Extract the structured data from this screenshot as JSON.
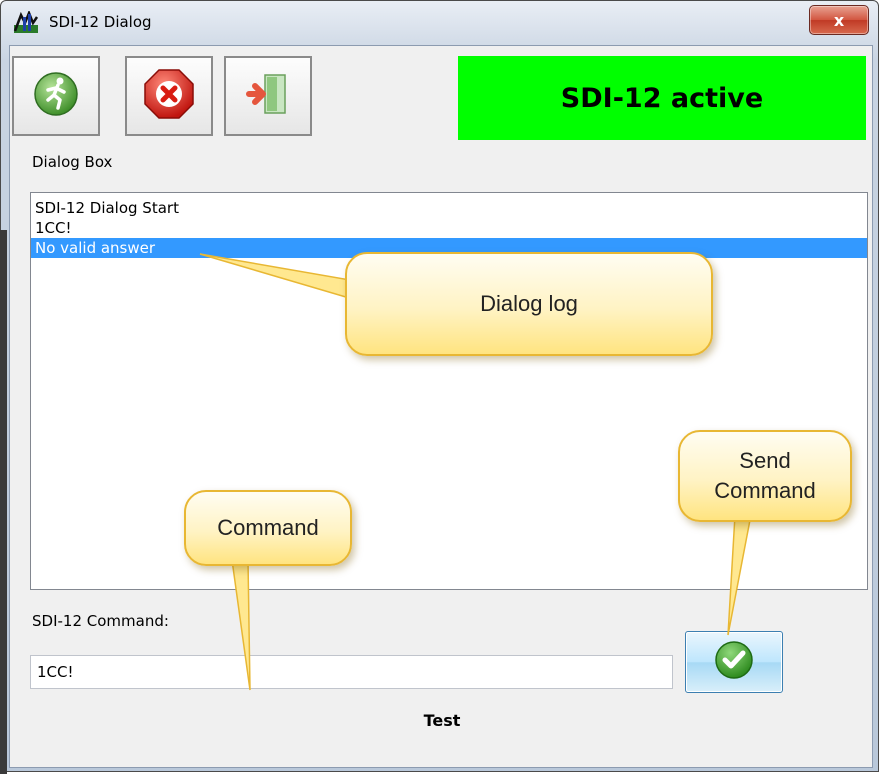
{
  "window": {
    "title": "SDI-12 Dialog",
    "close_label": "x"
  },
  "toolbar": {
    "run_icon": "running-man-icon",
    "stop_icon": "stop-x-icon",
    "exit_icon": "exit-door-icon"
  },
  "status": {
    "text": "SDI-12 active",
    "color": "#00ff00"
  },
  "dialog_box": {
    "label": "Dialog Box",
    "lines": [
      {
        "text": "SDI-12 Dialog Start",
        "selected": false
      },
      {
        "text": "1CC!",
        "selected": false
      },
      {
        "text": "No valid answer",
        "selected": true
      }
    ]
  },
  "command": {
    "label": "SDI-12 Command:",
    "value": "1CC!",
    "send_icon": "check-icon"
  },
  "footer": {
    "text": "Test"
  },
  "callouts": {
    "dialog_log": "Dialog log",
    "send_command_1": "Send",
    "send_command_2": "Command",
    "command": "Command"
  }
}
